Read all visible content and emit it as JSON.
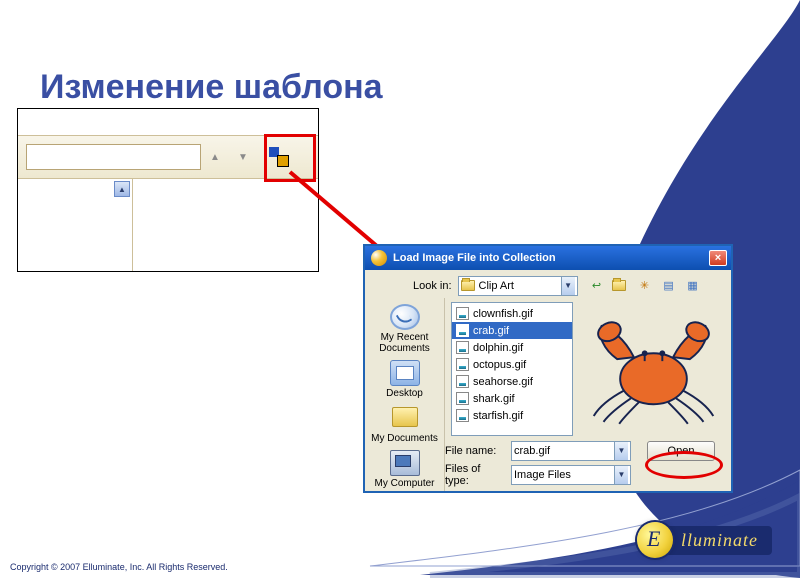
{
  "slide": {
    "title": "Изменение шаблона"
  },
  "dialog": {
    "title": "Load Image File into Collection",
    "look_in_label": "Look in:",
    "look_in_value": "Clip Art",
    "places": {
      "recent": "My Recent Documents",
      "desktop": "Desktop",
      "mydocs": "My Documents",
      "mycomp": "My Computer"
    },
    "files": [
      "clownfish.gif",
      "crab.gif",
      "dolphin.gif",
      "octopus.gif",
      "seahorse.gif",
      "shark.gif",
      "starfish.gif"
    ],
    "selected_index": 1,
    "file_name_label": "File name:",
    "file_name_value": "crab.gif",
    "files_of_type_label": "Files of type:",
    "files_of_type_value": "Image Files",
    "open_button": "Open"
  },
  "footer": {
    "logo_text": "lluminate",
    "copyright": "Copyright © 2007 Elluminate, Inc. All Rights Reserved."
  }
}
